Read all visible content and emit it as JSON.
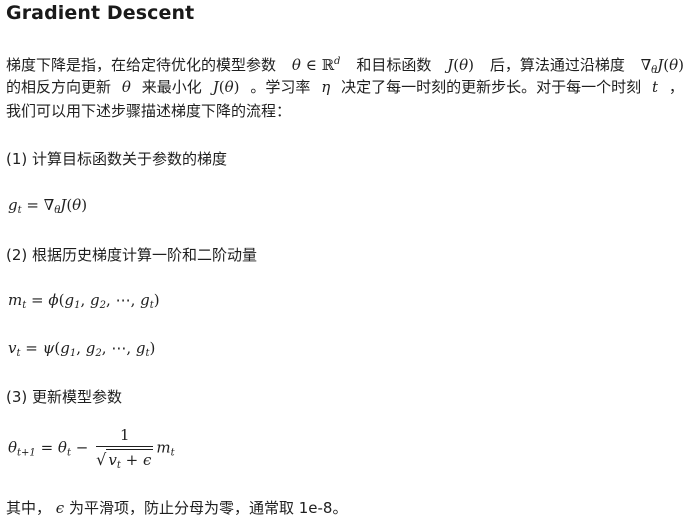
{
  "title": "Gradient Descent",
  "intro": {
    "l1_a": "梯度下降是指，在给定待优化的模型参数",
    "l1_b": "和目标函数",
    "l1_c": "后，算法通过沿梯度",
    "l2_a": "的相反方向更新",
    "l2_b": "来最小化",
    "l2_c": "。学习率",
    "l2_d": "决定了每一时刻的更新步长。对于每一个时刻",
    "l2_e": "，",
    "l3": "我们可以用下述步骤描述梯度下降的流程："
  },
  "steps": {
    "s1": "(1) 计算目标函数关于参数的梯度",
    "s2": "(2) 根据历史梯度计算一阶和二阶动量",
    "s3": "(3) 更新模型参数"
  },
  "footer": {
    "a": "其中，",
    "b": "为平滑项，防止分母为零，通常取 1e-8。"
  }
}
